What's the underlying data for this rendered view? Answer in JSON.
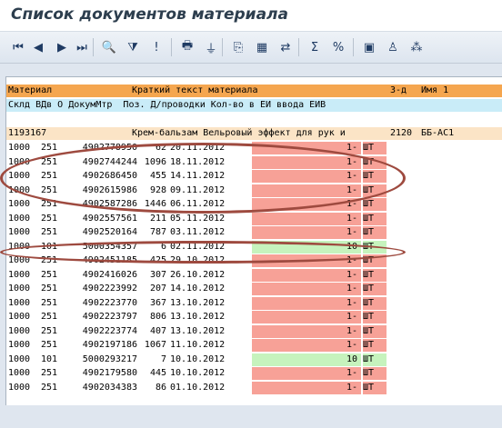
{
  "window": {
    "title": "Список документов материала"
  },
  "toolbar": {
    "buttons": [
      {
        "name": "first-page-icon",
        "glyph": "⏮"
      },
      {
        "name": "previous-page-icon",
        "glyph": "◀"
      },
      {
        "name": "next-page-icon",
        "glyph": "▶"
      },
      {
        "name": "last-page-icon",
        "glyph": "⏭"
      },
      {
        "name": "details-icon",
        "glyph": "🔍"
      },
      {
        "name": "filter-icon",
        "glyph": "⧩"
      },
      {
        "name": "warning-icon",
        "glyph": "!"
      },
      {
        "name": "print-icon",
        "glyph": "🖶"
      },
      {
        "name": "subtotal-icon",
        "glyph": "⏚"
      },
      {
        "name": "export-icon",
        "glyph": "⎘"
      },
      {
        "name": "layout-icon",
        "glyph": "▦"
      },
      {
        "name": "choose-layout-icon",
        "glyph": "⇄"
      },
      {
        "name": "sum-icon",
        "glyph": "Σ"
      },
      {
        "name": "percent-icon",
        "glyph": "%"
      },
      {
        "name": "save-layout-icon",
        "glyph": "▣"
      },
      {
        "name": "info-icon",
        "glyph": "♙"
      },
      {
        "name": "view-icon",
        "glyph": "⁂"
      }
    ]
  },
  "table": {
    "header_row1": {
      "material": "Материал",
      "short_text": "Краткий текст материала",
      "plant": "З-д",
      "name": "Имя 1"
    },
    "header_row2": {
      "columns": "Склд ВДв О ДокумМтр  Поз. Д/проводки Кол-во в ЕИ ввода ЕИВ"
    },
    "group": {
      "material": "1193167",
      "short_text": "Крем-бальзам Вельровый эффект для рук и",
      "plant": "2120",
      "name": "ББ-АС1"
    },
    "rows": [
      {
        "sloc": "1000",
        "mvt": "251",
        "doc": "4902778950",
        "pos": "62",
        "date": "20.11.2012",
        "qty": "1-",
        "unit": "ШТ",
        "hl": "red"
      },
      {
        "sloc": "1000",
        "mvt": "251",
        "doc": "4902744244",
        "pos": "1096",
        "date": "18.11.2012",
        "qty": "1-",
        "unit": "ШТ",
        "hl": "red"
      },
      {
        "sloc": "1000",
        "mvt": "251",
        "doc": "4902686450",
        "pos": "455",
        "date": "14.11.2012",
        "qty": "1-",
        "unit": "ШТ",
        "hl": "red"
      },
      {
        "sloc": "1000",
        "mvt": "251",
        "doc": "4902615986",
        "pos": "928",
        "date": "09.11.2012",
        "qty": "1-",
        "unit": "ШТ",
        "hl": "red"
      },
      {
        "sloc": "1000",
        "mvt": "251",
        "doc": "4902587286",
        "pos": "1446",
        "date": "06.11.2012",
        "qty": "1-",
        "unit": "ШТ",
        "hl": "red"
      },
      {
        "sloc": "1000",
        "mvt": "251",
        "doc": "4902557561",
        "pos": "211",
        "date": "05.11.2012",
        "qty": "1-",
        "unit": "ШТ",
        "hl": "red"
      },
      {
        "sloc": "1000",
        "mvt": "251",
        "doc": "4902520164",
        "pos": "787",
        "date": "03.11.2012",
        "qty": "1-",
        "unit": "ШТ",
        "hl": "red"
      },
      {
        "sloc": "1000",
        "mvt": "101",
        "doc": "5000354357",
        "pos": "6",
        "date": "02.11.2012",
        "qty": "10",
        "unit": "ШТ",
        "hl": "green"
      },
      {
        "sloc": "1000",
        "mvt": "251",
        "doc": "4902451185",
        "pos": "425",
        "date": "29.10.2012",
        "qty": "1-",
        "unit": "ШТ",
        "hl": "red"
      },
      {
        "sloc": "1000",
        "mvt": "251",
        "doc": "4902416026",
        "pos": "307",
        "date": "26.10.2012",
        "qty": "1-",
        "unit": "ШТ",
        "hl": "red"
      },
      {
        "sloc": "1000",
        "mvt": "251",
        "doc": "4902223992",
        "pos": "207",
        "date": "14.10.2012",
        "qty": "1-",
        "unit": "ШТ",
        "hl": "red"
      },
      {
        "sloc": "1000",
        "mvt": "251",
        "doc": "4902223770",
        "pos": "367",
        "date": "13.10.2012",
        "qty": "1-",
        "unit": "ШТ",
        "hl": "red"
      },
      {
        "sloc": "1000",
        "mvt": "251",
        "doc": "4902223797",
        "pos": "806",
        "date": "13.10.2012",
        "qty": "1-",
        "unit": "ШТ",
        "hl": "red"
      },
      {
        "sloc": "1000",
        "mvt": "251",
        "doc": "4902223774",
        "pos": "407",
        "date": "13.10.2012",
        "qty": "1-",
        "unit": "ШТ",
        "hl": "red"
      },
      {
        "sloc": "1000",
        "mvt": "251",
        "doc": "4902197186",
        "pos": "1067",
        "date": "11.10.2012",
        "qty": "1-",
        "unit": "ШТ",
        "hl": "red"
      },
      {
        "sloc": "1000",
        "mvt": "101",
        "doc": "5000293217",
        "pos": "7",
        "date": "10.10.2012",
        "qty": "10",
        "unit": "ШТ",
        "hl": "green"
      },
      {
        "sloc": "1000",
        "mvt": "251",
        "doc": "4902179580",
        "pos": "445",
        "date": "10.10.2012",
        "qty": "1-",
        "unit": "ШТ",
        "hl": "red"
      },
      {
        "sloc": "1000",
        "mvt": "251",
        "doc": "4902034383",
        "pos": "86",
        "date": "01.10.2012",
        "qty": "1-",
        "unit": "ШТ",
        "hl": "red"
      }
    ]
  },
  "colors": {
    "header_orange": "#f5a64f",
    "header_blue": "#c9ecf8",
    "group_row": "#fbe4c6",
    "negative_qty": "#f7a197",
    "positive_qty": "#c6f3bd",
    "annotation": "#9e4a3f"
  }
}
